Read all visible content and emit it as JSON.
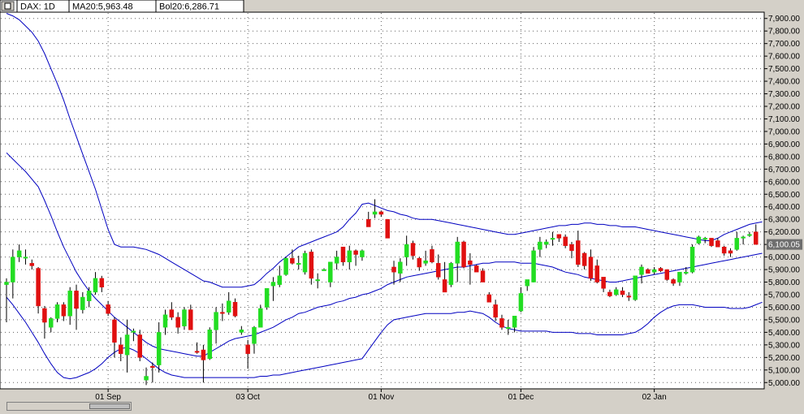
{
  "legend": {
    "symbol": "DAX: 1D",
    "ma": "MA20:5,963.48",
    "bol": "Bol20:6,286.71",
    "icon": "window-restore-icon"
  },
  "colors": {
    "up": "#22dd22",
    "down": "#e01010",
    "band": "#0000c0",
    "grid": "#606060",
    "price_marker_bg": "#6e6e6e"
  },
  "chart_data": {
    "type": "candlestick",
    "title": "",
    "ylim": [
      4950,
      7950
    ],
    "ytick_step": 100,
    "grid": true,
    "ytick_labels": [
      "5,000.00",
      "5,100.00",
      "5,200.00",
      "5,300.00",
      "5,400.00",
      "5,500.00",
      "5,600.00",
      "5,700.00",
      "5,800.00",
      "5,900.00",
      "6,000.00",
      "6,100.00",
      "6,200.00",
      "6,300.00",
      "6,400.00",
      "6,500.00",
      "6,600.00",
      "6,700.00",
      "6,800.00",
      "6,900.00",
      "7,000.00",
      "7,100.00",
      "7,200.00",
      "7,300.00",
      "7,400.00",
      "7,500.00",
      "7,600.00",
      "7,700.00",
      "7,800.00",
      "7,900.00"
    ],
    "x_labels": [
      {
        "label": "01 Sep",
        "index": 16
      },
      {
        "label": "03 Oct",
        "index": 38
      },
      {
        "label": "01 Nov",
        "index": 59
      },
      {
        "label": "01 Dec",
        "index": 81
      },
      {
        "label": "02 Jan",
        "index": 102
      }
    ],
    "last_price": "6,100.05",
    "candles": [
      [
        5780,
        5830,
        5480,
        5800
      ],
      [
        5800,
        6060,
        5670,
        6000
      ],
      [
        6000,
        6100,
        5960,
        6050
      ],
      [
        6000,
        6060,
        5940,
        6000
      ],
      [
        5950,
        5980,
        5900,
        5930
      ],
      [
        5910,
        5920,
        5550,
        5610
      ],
      [
        5590,
        5610,
        5350,
        5480
      ],
      [
        5440,
        5520,
        5400,
        5510
      ],
      [
        5510,
        5640,
        5480,
        5620
      ],
      [
        5620,
        5640,
        5490,
        5530
      ],
      [
        5530,
        5760,
        5460,
        5730
      ],
      [
        5730,
        5780,
        5420,
        5590
      ],
      [
        5580,
        5720,
        5550,
        5680
      ],
      [
        5650,
        5760,
        5600,
        5730
      ],
      [
        5720,
        5880,
        5700,
        5830
      ],
      [
        5830,
        5850,
        5720,
        5760
      ],
      [
        5620,
        5650,
        5530,
        5550
      ],
      [
        5500,
        5520,
        5200,
        5320
      ],
      [
        5300,
        5360,
        5170,
        5230
      ],
      [
        5220,
        5500,
        5080,
        5380
      ],
      [
        5400,
        5430,
        5330,
        5410
      ],
      [
        5380,
        5420,
        5170,
        5200
      ],
      [
        5020,
        5120,
        4980,
        5050
      ],
      [
        5130,
        5160,
        5000,
        5120
      ],
      [
        5140,
        5480,
        5080,
        5400
      ],
      [
        5440,
        5580,
        5380,
        5540
      ],
      [
        5580,
        5640,
        5500,
        5520
      ],
      [
        5520,
        5560,
        5390,
        5440
      ],
      [
        5450,
        5600,
        5420,
        5580
      ],
      [
        5580,
        5620,
        5420,
        5420
      ],
      [
        5250,
        5320,
        5230,
        5240
      ],
      [
        5260,
        5300,
        5000,
        5180
      ],
      [
        5190,
        5440,
        5180,
        5420
      ],
      [
        5420,
        5600,
        5310,
        5560
      ],
      [
        5560,
        5630,
        5490,
        5550
      ],
      [
        5560,
        5720,
        5540,
        5650
      ],
      [
        5640,
        5670,
        5520,
        5530
      ],
      [
        5400,
        5450,
        5380,
        5420
      ],
      [
        5300,
        5340,
        5110,
        5230
      ],
      [
        5310,
        5450,
        5230,
        5440
      ],
      [
        5440,
        5620,
        5440,
        5590
      ],
      [
        5600,
        5750,
        5580,
        5750
      ],
      [
        5770,
        5840,
        5650,
        5800
      ],
      [
        5780,
        5930,
        5760,
        5850
      ],
      [
        5860,
        6000,
        5850,
        5990
      ],
      [
        5990,
        6060,
        5940,
        5950
      ],
      [
        5950,
        6010,
        5900,
        5950
      ],
      [
        5880,
        6050,
        5860,
        6030
      ],
      [
        6040,
        6060,
        5780,
        5830
      ],
      [
        5810,
        5870,
        5750,
        5820
      ],
      [
        5900,
        5910,
        5890,
        5900
      ],
      [
        5800,
        5920,
        5760,
        5960
      ],
      [
        5950,
        6050,
        5900,
        6000
      ],
      [
        6080,
        6050,
        5930,
        5960
      ],
      [
        5960,
        6090,
        5900,
        6050
      ],
      [
        6050,
        6060,
        5930,
        6020
      ],
      [
        6000,
        6060,
        5970,
        6050
      ],
      [
        6300,
        6360,
        6270,
        6240
      ],
      [
        6340,
        6460,
        6310,
        6360
      ],
      [
        6360,
        6370,
        6320,
        6340
      ],
      [
        6300,
        6300,
        6150,
        6150
      ],
      [
        5920,
        5970,
        5780,
        5880
      ],
      [
        5870,
        5990,
        5800,
        5960
      ],
      [
        6000,
        6170,
        5930,
        6100
      ],
      [
        6110,
        6130,
        5980,
        6010
      ],
      [
        5990,
        6000,
        5890,
        5920
      ],
      [
        5950,
        6050,
        5930,
        5970
      ],
      [
        6060,
        6090,
        5950,
        5960
      ],
      [
        5950,
        6020,
        5820,
        5840
      ],
      [
        5820,
        5960,
        5740,
        5720
      ],
      [
        5780,
        5960,
        5760,
        5950
      ],
      [
        5950,
        6160,
        5800,
        6120
      ],
      [
        6120,
        6130,
        5910,
        5920
      ],
      [
        5970,
        6030,
        5780,
        5940
      ],
      [
        5930,
        5940,
        5880,
        5880
      ],
      [
        5890,
        5910,
        5810,
        5800
      ],
      [
        5700,
        5720,
        5650,
        5640
      ],
      [
        5620,
        5660,
        5490,
        5520
      ],
      [
        5510,
        5540,
        5420,
        5440
      ],
      [
        5440,
        5500,
        5380,
        5440
      ],
      [
        5440,
        5520,
        5400,
        5530
      ],
      [
        5570,
        5760,
        5560,
        5710
      ],
      [
        5770,
        5810,
        5730,
        5820
      ],
      [
        5800,
        6080,
        5800,
        6050
      ],
      [
        6060,
        6160,
        6000,
        6120
      ],
      [
        6100,
        6140,
        6070,
        6120
      ],
      [
        6140,
        6200,
        6090,
        6150
      ],
      [
        6180,
        6170,
        6120,
        6150
      ],
      [
        6160,
        6180,
        6070,
        6090
      ],
      [
        6100,
        6120,
        5990,
        6050
      ],
      [
        6130,
        6210,
        5920,
        5940
      ],
      [
        6030,
        6040,
        5900,
        5930
      ],
      [
        6000,
        6060,
        5810,
        5830
      ],
      [
        5930,
        5980,
        5790,
        5800
      ],
      [
        5840,
        5830,
        5720,
        5750
      ],
      [
        5720,
        5740,
        5680,
        5690
      ],
      [
        5700,
        5760,
        5690,
        5740
      ],
      [
        5730,
        5760,
        5680,
        5700
      ],
      [
        5690,
        5720,
        5650,
        5680
      ],
      [
        5660,
        5840,
        5650,
        5850
      ],
      [
        5860,
        5940,
        5790,
        5920
      ],
      [
        5900,
        5910,
        5870,
        5870
      ],
      [
        5880,
        5920,
        5860,
        5900
      ],
      [
        5910,
        5920,
        5880,
        5890
      ],
      [
        5900,
        5900,
        5810,
        5820
      ],
      [
        5820,
        5830,
        5770,
        5790
      ],
      [
        5800,
        5880,
        5770,
        5880
      ],
      [
        5870,
        5920,
        5860,
        5880
      ],
      [
        5880,
        6100,
        5870,
        6080
      ],
      [
        6110,
        6170,
        6100,
        6160
      ],
      [
        6140,
        6160,
        6110,
        6150
      ],
      [
        6150,
        6150,
        6080,
        6090
      ],
      [
        6130,
        6150,
        6080,
        6080
      ],
      [
        6080,
        6090,
        6010,
        6030
      ],
      [
        6050,
        6070,
        6000,
        6030
      ],
      [
        6060,
        6200,
        6050,
        6150
      ],
      [
        6150,
        6170,
        6100,
        6160
      ],
      [
        6180,
        6200,
        6160,
        6180
      ],
      [
        6200,
        6260,
        6100,
        6100
      ]
    ],
    "ma": [
      6830,
      6780,
      6730,
      6680,
      6620,
      6560,
      6450,
      6330,
      6200,
      6080,
      5980,
      5880,
      5800,
      5730,
      5670,
      5620,
      5570,
      5520,
      5480,
      5440,
      5400,
      5360,
      5320,
      5290,
      5270,
      5260,
      5250,
      5240,
      5230,
      5220,
      5210,
      5210,
      5240,
      5270,
      5300,
      5330,
      5350,
      5360,
      5370,
      5380,
      5400,
      5420,
      5440,
      5470,
      5500,
      5520,
      5550,
      5560,
      5580,
      5600,
      5610,
      5620,
      5640,
      5650,
      5670,
      5680,
      5700,
      5710,
      5730,
      5750,
      5780,
      5800,
      5820,
      5840,
      5850,
      5860,
      5870,
      5880,
      5890,
      5900,
      5910,
      5920,
      5920,
      5930,
      5940,
      5950,
      5950,
      5960,
      5960,
      5960,
      5960,
      5950,
      5950,
      5950,
      5940,
      5930,
      5920,
      5900,
      5880,
      5870,
      5860,
      5840,
      5830,
      5820,
      5810,
      5800,
      5800,
      5810,
      5820,
      5830,
      5840,
      5850,
      5860,
      5870,
      5880,
      5890,
      5900,
      5910,
      5920,
      5930,
      5940,
      5950,
      5960,
      5970,
      5980,
      5990,
      6000,
      6010,
      6020,
      6030
    ],
    "upper": [
      7940,
      7920,
      7890,
      7840,
      7790,
      7720,
      7620,
      7500,
      7380,
      7250,
      7100,
      6960,
      6820,
      6680,
      6540,
      6380,
      6220,
      6100,
      6080,
      6080,
      6080,
      6070,
      6060,
      6040,
      6020,
      5990,
      5960,
      5930,
      5900,
      5870,
      5840,
      5810,
      5800,
      5780,
      5760,
      5760,
      5760,
      5760,
      5770,
      5780,
      5820,
      5870,
      5910,
      5960,
      6000,
      6040,
      6080,
      6100,
      6120,
      6140,
      6160,
      6180,
      6200,
      6240,
      6300,
      6350,
      6420,
      6430,
      6410,
      6390,
      6370,
      6360,
      6340,
      6330,
      6310,
      6300,
      6300,
      6300,
      6290,
      6280,
      6270,
      6260,
      6250,
      6240,
      6230,
      6220,
      6210,
      6200,
      6190,
      6180,
      6180,
      6190,
      6200,
      6210,
      6220,
      6230,
      6240,
      6250,
      6250,
      6260,
      6260,
      6270,
      6270,
      6260,
      6260,
      6250,
      6250,
      6240,
      6240,
      6240,
      6230,
      6220,
      6210,
      6200,
      6190,
      6180,
      6170,
      6160,
      6150,
      6140,
      6130,
      6130,
      6150,
      6180,
      6200,
      6220,
      6240,
      6260,
      6270,
      6280
    ],
    "lower": [
      5680,
      5620,
      5550,
      5480,
      5400,
      5320,
      5230,
      5150,
      5080,
      5040,
      5030,
      5040,
      5060,
      5080,
      5110,
      5150,
      5200,
      5240,
      5270,
      5280,
      5260,
      5230,
      5190,
      5150,
      5110,
      5080,
      5060,
      5050,
      5040,
      5040,
      5040,
      5040,
      5040,
      5040,
      5040,
      5040,
      5040,
      5040,
      5040,
      5040,
      5050,
      5050,
      5060,
      5060,
      5070,
      5080,
      5090,
      5100,
      5110,
      5120,
      5130,
      5140,
      5150,
      5160,
      5170,
      5180,
      5190,
      5260,
      5330,
      5400,
      5460,
      5500,
      5510,
      5520,
      5530,
      5540,
      5550,
      5550,
      5550,
      5550,
      5550,
      5560,
      5560,
      5570,
      5560,
      5550,
      5520,
      5480,
      5450,
      5430,
      5420,
      5410,
      5410,
      5410,
      5410,
      5410,
      5400,
      5400,
      5400,
      5400,
      5390,
      5390,
      5390,
      5380,
      5380,
      5380,
      5380,
      5380,
      5390,
      5400,
      5430,
      5470,
      5520,
      5560,
      5590,
      5610,
      5620,
      5620,
      5620,
      5610,
      5600,
      5600,
      5600,
      5600,
      5590,
      5590,
      5590,
      5600,
      5620,
      5640
    ]
  }
}
